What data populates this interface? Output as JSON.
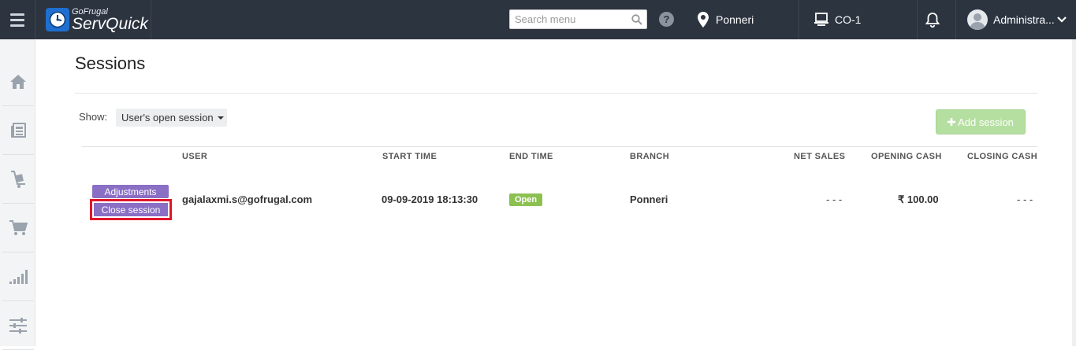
{
  "topbar": {
    "brand_small": "GoFrugal",
    "brand_big": "ServQuick",
    "search_placeholder": "Search menu",
    "help_label": "?",
    "location": "Ponneri",
    "counter": "CO-1",
    "user_name": "Administra..."
  },
  "sidebar": {
    "items": [
      {
        "icon": "home-icon"
      },
      {
        "icon": "catalog-icon"
      },
      {
        "icon": "inventory-icon"
      },
      {
        "icon": "cart-icon"
      },
      {
        "icon": "reports-icon"
      },
      {
        "icon": "settings-icon"
      }
    ]
  },
  "page": {
    "title": "Sessions",
    "show_label": "Show:",
    "show_value": "User's open session",
    "add_session_label": "Add session"
  },
  "table": {
    "headers": {
      "user": "USER",
      "start_time": "START TIME",
      "end_time": "END TIME",
      "branch": "BRANCH",
      "net_sales": "NET SALES",
      "opening_cash": "OPENING CASH",
      "closing_cash": "CLOSING CASH"
    },
    "rows": [
      {
        "adjustments_label": "Adjustments",
        "close_label": "Close session",
        "user": "gajalaxmi.s@gofrugal.com",
        "start_time": "09-09-2019 18:13:30",
        "end_time_status": "Open",
        "branch": "Ponneri",
        "net_sales": "- - -",
        "opening_cash": "₹ 100.00",
        "closing_cash": "- - -"
      }
    ]
  },
  "colors": {
    "topbar_bg": "#2c3440",
    "action_purple": "#8a6fc4",
    "open_badge": "#8cc152",
    "add_button": "#b5dfa0",
    "highlight_red": "#e0162b"
  }
}
